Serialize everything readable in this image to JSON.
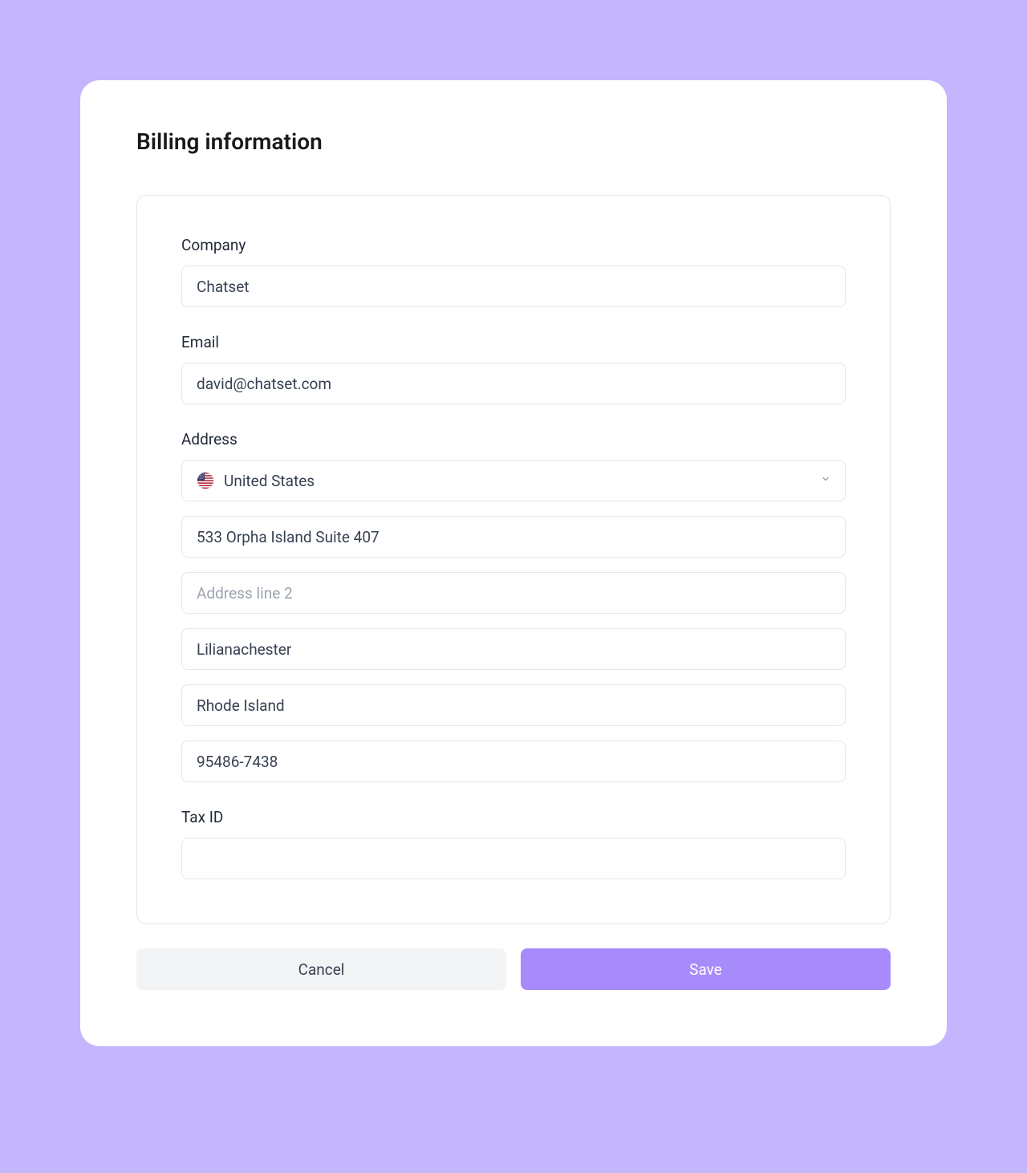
{
  "header": {
    "title": "Billing information"
  },
  "form": {
    "company": {
      "label": "Company",
      "value": "Chatset"
    },
    "email": {
      "label": "Email",
      "value": "david@chatset.com"
    },
    "address": {
      "label": "Address",
      "country": "United States",
      "line1": "533 Orpha Island Suite 407",
      "line2": "",
      "line2_placeholder": "Address line 2",
      "city": "Lilianachester",
      "state": "Rhode Island",
      "postal": "95486-7438"
    },
    "tax_id": {
      "label": "Tax ID",
      "value": ""
    }
  },
  "actions": {
    "cancel": "Cancel",
    "save": "Save"
  }
}
